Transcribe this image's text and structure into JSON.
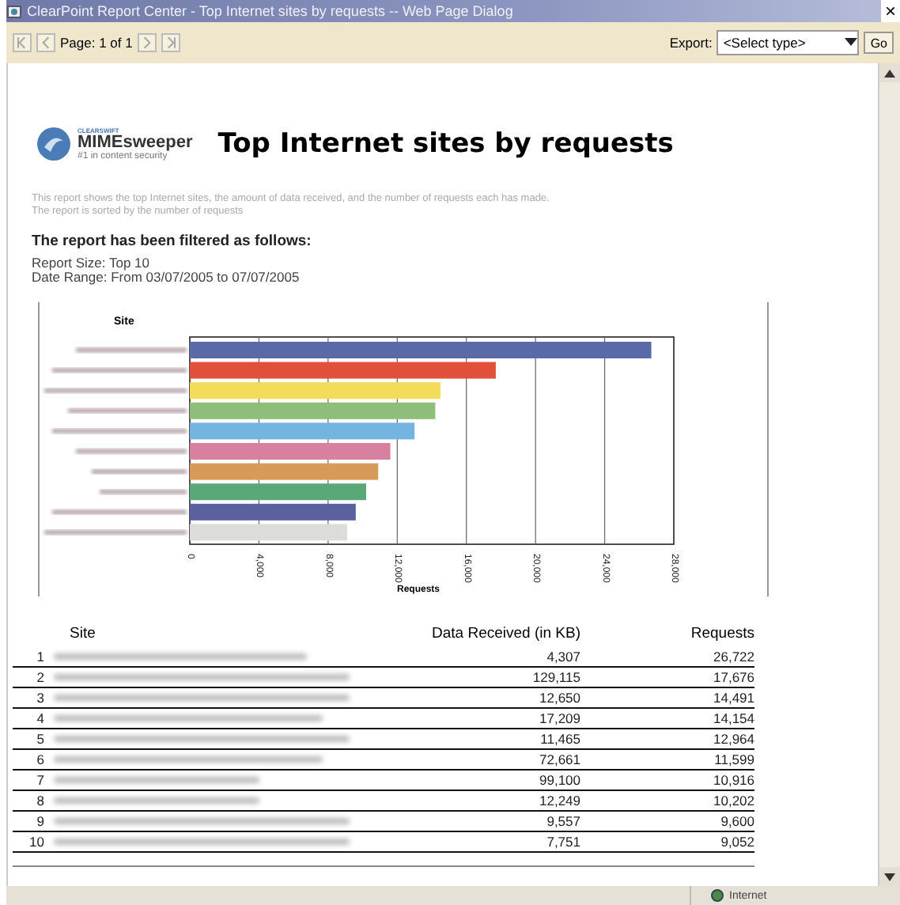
{
  "window": {
    "title": "ClearPoint Report Center - Top Internet sites by requests -- Web Page Dialog",
    "close": "×"
  },
  "toolbar": {
    "page": "Page: 1 of 1",
    "export_label": "Export:",
    "export_select": "<Select type>",
    "go": "Go"
  },
  "logo": {
    "brand_top": "CLEARSWIFT",
    "brand": "MIMEsweeper",
    "tagline": "#1 in content security"
  },
  "report": {
    "title": "Top Internet sites by requests",
    "description": [
      "This report shows the top Internet sites, the amount of data received, and the number of requests each has made.",
      "The report is sorted by the number of requests"
    ],
    "filter_heading": "The report has been filtered as follows:",
    "filters": [
      "Report Size: Top 10",
      "Date Range: From 03/07/2005 to 07/07/2005"
    ]
  },
  "chart": {
    "chart_data": {
      "type": "bar",
      "orientation": "horizontal",
      "ylabel": "Site",
      "grid": true,
      "series": [
        {
          "name": "Requests",
          "values": [
            26700,
            17700,
            14500,
            14200,
            13000,
            11600,
            10900,
            10200,
            9600,
            9100
          ]
        }
      ],
      "colors": [
        "#5a6aa8",
        "#e0503a",
        "#f2dc5a",
        "#8fbd7a",
        "#74b4e0",
        "#d880a0",
        "#d89a58",
        "#5aa878",
        "#5a60a0",
        "#dcdcd8"
      ],
      "xlim": [
        0,
        28000
      ],
      "xticks": [
        {
          "value": 0,
          "label": "0"
        },
        {
          "value": 4000,
          "label": "4,000"
        },
        {
          "value": 8000,
          "label": "8,000"
        },
        {
          "value": 12000,
          "label": "12,000"
        },
        {
          "value": 16000,
          "label": "16,000"
        },
        {
          "value": 20000,
          "label": "20,000"
        },
        {
          "value": 24000,
          "label": "24,000"
        },
        {
          "value": 28000,
          "label": "28,000"
        }
      ]
    }
  },
  "table": {
    "columns": [
      "Site",
      "Data Received (in KB)",
      "Requests"
    ],
    "rows": [
      {
        "rank": "1",
        "data": "4,307",
        "requests": "26,722"
      },
      {
        "rank": "2",
        "data": "129,115",
        "requests": "17,676"
      },
      {
        "rank": "3",
        "data": "12,650",
        "requests": "14,491"
      },
      {
        "rank": "4",
        "data": "17,209",
        "requests": "14,154"
      },
      {
        "rank": "5",
        "data": "11,465",
        "requests": "12,964"
      },
      {
        "rank": "6",
        "data": "72,661",
        "requests": "11,599"
      },
      {
        "rank": "7",
        "data": "99,100",
        "requests": "10,916"
      },
      {
        "rank": "8",
        "data": "12,249",
        "requests": "10,202"
      },
      {
        "rank": "9",
        "data": "9,557",
        "requests": "9,600"
      },
      {
        "rank": "10",
        "data": "7,751",
        "requests": "9,052"
      }
    ]
  },
  "status_bar": {
    "zone": "Internet"
  }
}
